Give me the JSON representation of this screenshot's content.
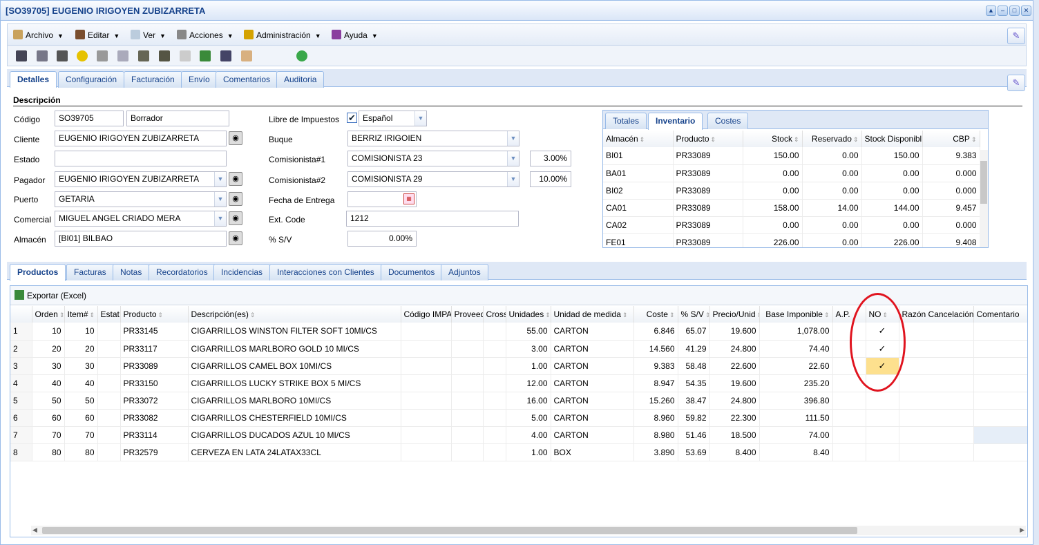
{
  "window": {
    "title": "[SO39705] EUGENIO IRIGOYEN ZUBIZARRETA"
  },
  "menu": [
    "Archivo",
    "Editar",
    "Ver",
    "Acciones",
    "Administración",
    "Ayuda"
  ],
  "top_tabs": [
    "Detalles",
    "Configuración",
    "Facturación",
    "Envío",
    "Comentarios",
    "Auditoria"
  ],
  "section": "Descripción",
  "form": {
    "codigo_label": "Código",
    "codigo": "SO39705",
    "estado_doc": "Borrador",
    "cliente_label": "Cliente",
    "cliente": "EUGENIO IRIGOYEN ZUBIZARRETA",
    "estado_label": "Estado",
    "estado": "",
    "pagador_label": "Pagador",
    "pagador": "EUGENIO IRIGOYEN ZUBIZARRETA",
    "puerto_label": "Puerto",
    "puerto": "GETARIA",
    "comercial_label": "Comercial",
    "comercial": "MIGUEL ANGEL CRIADO MERA",
    "almacen_label": "Almacén",
    "almacen": "[BI01] BILBAO",
    "libre_label": "Libre de Impuestos",
    "idioma": "Español",
    "buque_label": "Buque",
    "buque": "BERRIZ IRIGOIEN",
    "com1_label": "Comisionista#1",
    "com1": "COMISIONISTA 23",
    "com1_pct": "3.00%",
    "com2_label": "Comisionista#2",
    "com2": "COMISIONISTA 29",
    "com2_pct": "10.00%",
    "fecha_label": "Fecha de Entrega",
    "fecha": "",
    "ext_label": "Ext. Code",
    "ext": "1212",
    "sv_label": "% S/V",
    "sv": "0.00%"
  },
  "inv_tabs": [
    "Totales",
    "Inventario",
    "Costes"
  ],
  "inventory": {
    "headers": [
      "Almacén",
      "Producto",
      "Stock",
      "Reservado",
      "Stock Disponibl",
      "CBP"
    ],
    "rows": [
      [
        "BI01",
        "PR33089",
        "150.00",
        "0.00",
        "150.00",
        "9.383"
      ],
      [
        "BA01",
        "PR33089",
        "0.00",
        "0.00",
        "0.00",
        "0.000"
      ],
      [
        "BI02",
        "PR33089",
        "0.00",
        "0.00",
        "0.00",
        "0.000"
      ],
      [
        "CA01",
        "PR33089",
        "158.00",
        "14.00",
        "144.00",
        "9.457"
      ],
      [
        "CA02",
        "PR33089",
        "0.00",
        "0.00",
        "0.00",
        "0.000"
      ],
      [
        "FE01",
        "PR33089",
        "226.00",
        "0.00",
        "226.00",
        "9.408"
      ]
    ]
  },
  "bottom_tabs": [
    "Productos",
    "Facturas",
    "Notas",
    "Recordatorios",
    "Incidencias",
    "Interacciones con Clientes",
    "Documentos",
    "Adjuntos"
  ],
  "export_label": "Exportar (Excel)",
  "products": {
    "headers": [
      "Orden",
      "Item#",
      "Estat",
      "Producto",
      "Descripción(es)",
      "Código IMPA",
      "Proveed",
      "Cross",
      "Unidades",
      "Unidad de medida",
      "Coste",
      "% S/V",
      "Precio/Unid",
      "Base Imponible",
      "A.P.",
      "NO",
      "Razón Cancelación",
      "Comentario"
    ],
    "rows": [
      [
        "1",
        "10",
        "10",
        "",
        "PR33145",
        "CIGARRILLOS WINSTON FILTER SOFT 10MI/CS",
        "",
        "",
        "",
        "55.00",
        "CARTON",
        "6.846",
        "65.07",
        "19.600",
        "1,078.00",
        "",
        "✓"
      ],
      [
        "2",
        "20",
        "20",
        "",
        "PR33117",
        "CIGARRILLOS MARLBORO GOLD 10 MI/CS",
        "",
        "",
        "",
        "3.00",
        "CARTON",
        "14.560",
        "41.29",
        "24.800",
        "74.40",
        "",
        "✓"
      ],
      [
        "3",
        "30",
        "30",
        "",
        "PR33089",
        "CIGARRILLOS CAMEL BOX 10MI/CS",
        "",
        "",
        "",
        "1.00",
        "CARTON",
        "9.383",
        "58.48",
        "22.600",
        "22.60",
        "",
        "✓"
      ],
      [
        "4",
        "40",
        "40",
        "",
        "PR33150",
        "CIGARRILLOS LUCKY STRIKE BOX 5 MI/CS",
        "",
        "",
        "",
        "12.00",
        "CARTON",
        "8.947",
        "54.35",
        "19.600",
        "235.20",
        "",
        ""
      ],
      [
        "5",
        "50",
        "50",
        "",
        "PR33072",
        "CIGARRILLOS MARLBORO 10MI/CS",
        "",
        "",
        "",
        "16.00",
        "CARTON",
        "15.260",
        "38.47",
        "24.800",
        "396.80",
        "",
        ""
      ],
      [
        "6",
        "60",
        "60",
        "",
        "PR33082",
        "CIGARRILLOS CHESTERFIELD 10MI/CS",
        "",
        "",
        "",
        "5.00",
        "CARTON",
        "8.960",
        "59.82",
        "22.300",
        "111.50",
        "",
        ""
      ],
      [
        "7",
        "70",
        "70",
        "",
        "PR33114",
        "CIGARRILLOS DUCADOS AZUL 10 MI/CS",
        "",
        "",
        "",
        "4.00",
        "CARTON",
        "8.980",
        "51.46",
        "18.500",
        "74.00",
        "",
        ""
      ],
      [
        "8",
        "80",
        "80",
        "",
        "PR32579",
        "CERVEZA EN LATA 24LATAX33CL",
        "",
        "",
        "",
        "1.00",
        "BOX",
        "3.890",
        "53.69",
        "8.400",
        "8.40",
        "",
        ""
      ]
    ]
  }
}
